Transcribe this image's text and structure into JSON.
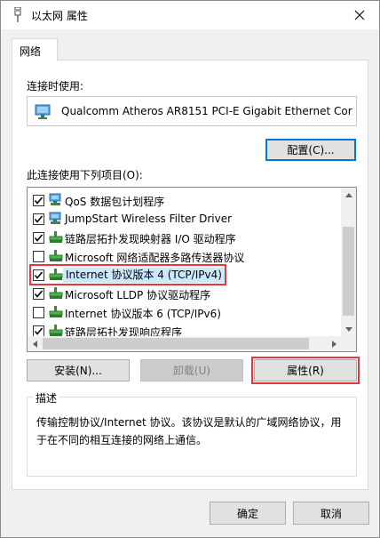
{
  "window": {
    "title": "以太网 属性"
  },
  "tabs": [
    {
      "label": "网络"
    }
  ],
  "connect_using": {
    "label": "连接时使用:",
    "adapter_name": "Qualcomm Atheros AR8151 PCI-E Gigabit Ethernet Cor"
  },
  "configure_button": "配置(C)...",
  "items_label": "此连接使用下列项目(O):",
  "items": [
    {
      "label": "QoS 数据包计划程序",
      "checked": true,
      "icon": "network-client-icon"
    },
    {
      "label": "JumpStart Wireless Filter Driver",
      "checked": true,
      "icon": "network-client-icon"
    },
    {
      "label": "链路层拓扑发现映射器 I/O 驱动程序",
      "checked": true,
      "icon": "network-protocol-icon"
    },
    {
      "label": "Microsoft 网络适配器多路传送器协议",
      "checked": false,
      "icon": "network-protocol-icon"
    },
    {
      "label": "Internet 协议版本 4 (TCP/IPv4)",
      "checked": true,
      "icon": "network-protocol-icon",
      "selected": true
    },
    {
      "label": "Microsoft LLDP 协议驱动程序",
      "checked": true,
      "icon": "network-protocol-icon"
    },
    {
      "label": "Internet 协议版本 6 (TCP/IPv6)",
      "checked": false,
      "icon": "network-protocol-icon"
    },
    {
      "label": "链路层拓扑发现响应程序",
      "checked": true,
      "icon": "network-protocol-icon"
    }
  ],
  "buttons": {
    "install": "安装(N)...",
    "uninstall": "卸载(U)",
    "properties": "属性(R)",
    "ok": "确定",
    "cancel": "取消"
  },
  "description": {
    "title": "描述",
    "text": "传输控制协议/Internet 协议。该协议是默认的广域网络协议，用于在不同的相互连接的网络上通信。"
  },
  "colors": {
    "highlight_red": "#e0393e",
    "selection_blue": "#cce8ff",
    "accent": "#0078d7"
  }
}
